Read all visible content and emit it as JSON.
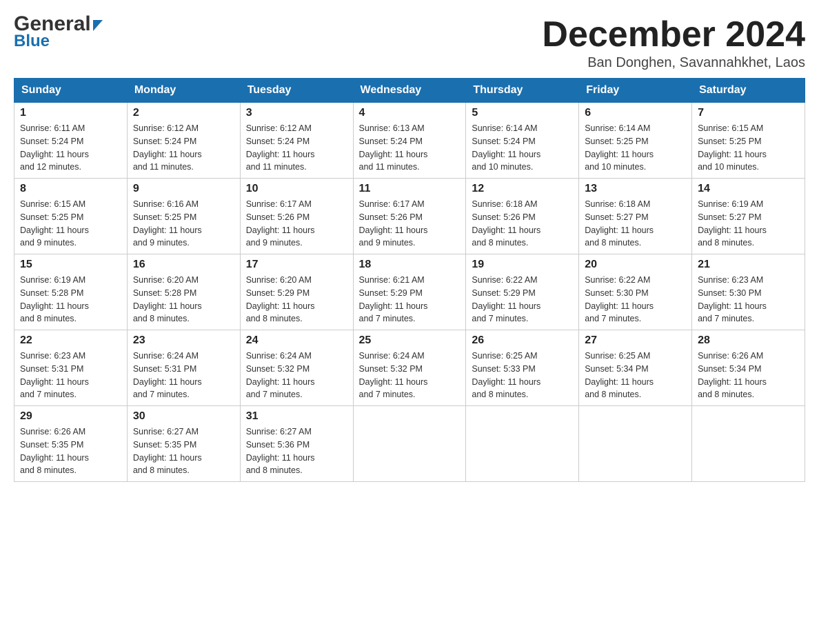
{
  "header": {
    "logo_top": "General",
    "logo_bottom": "Blue",
    "month_title": "December 2024",
    "location": "Ban Donghen, Savannahkhet, Laos"
  },
  "days_of_week": [
    "Sunday",
    "Monday",
    "Tuesday",
    "Wednesday",
    "Thursday",
    "Friday",
    "Saturday"
  ],
  "weeks": [
    [
      {
        "day": "1",
        "sunrise": "6:11 AM",
        "sunset": "5:24 PM",
        "daylight": "11 hours and 12 minutes."
      },
      {
        "day": "2",
        "sunrise": "6:12 AM",
        "sunset": "5:24 PM",
        "daylight": "11 hours and 11 minutes."
      },
      {
        "day": "3",
        "sunrise": "6:12 AM",
        "sunset": "5:24 PM",
        "daylight": "11 hours and 11 minutes."
      },
      {
        "day": "4",
        "sunrise": "6:13 AM",
        "sunset": "5:24 PM",
        "daylight": "11 hours and 11 minutes."
      },
      {
        "day": "5",
        "sunrise": "6:14 AM",
        "sunset": "5:24 PM",
        "daylight": "11 hours and 10 minutes."
      },
      {
        "day": "6",
        "sunrise": "6:14 AM",
        "sunset": "5:25 PM",
        "daylight": "11 hours and 10 minutes."
      },
      {
        "day": "7",
        "sunrise": "6:15 AM",
        "sunset": "5:25 PM",
        "daylight": "11 hours and 10 minutes."
      }
    ],
    [
      {
        "day": "8",
        "sunrise": "6:15 AM",
        "sunset": "5:25 PM",
        "daylight": "11 hours and 9 minutes."
      },
      {
        "day": "9",
        "sunrise": "6:16 AM",
        "sunset": "5:25 PM",
        "daylight": "11 hours and 9 minutes."
      },
      {
        "day": "10",
        "sunrise": "6:17 AM",
        "sunset": "5:26 PM",
        "daylight": "11 hours and 9 minutes."
      },
      {
        "day": "11",
        "sunrise": "6:17 AM",
        "sunset": "5:26 PM",
        "daylight": "11 hours and 9 minutes."
      },
      {
        "day": "12",
        "sunrise": "6:18 AM",
        "sunset": "5:26 PM",
        "daylight": "11 hours and 8 minutes."
      },
      {
        "day": "13",
        "sunrise": "6:18 AM",
        "sunset": "5:27 PM",
        "daylight": "11 hours and 8 minutes."
      },
      {
        "day": "14",
        "sunrise": "6:19 AM",
        "sunset": "5:27 PM",
        "daylight": "11 hours and 8 minutes."
      }
    ],
    [
      {
        "day": "15",
        "sunrise": "6:19 AM",
        "sunset": "5:28 PM",
        "daylight": "11 hours and 8 minutes."
      },
      {
        "day": "16",
        "sunrise": "6:20 AM",
        "sunset": "5:28 PM",
        "daylight": "11 hours and 8 minutes."
      },
      {
        "day": "17",
        "sunrise": "6:20 AM",
        "sunset": "5:29 PM",
        "daylight": "11 hours and 8 minutes."
      },
      {
        "day": "18",
        "sunrise": "6:21 AM",
        "sunset": "5:29 PM",
        "daylight": "11 hours and 7 minutes."
      },
      {
        "day": "19",
        "sunrise": "6:22 AM",
        "sunset": "5:29 PM",
        "daylight": "11 hours and 7 minutes."
      },
      {
        "day": "20",
        "sunrise": "6:22 AM",
        "sunset": "5:30 PM",
        "daylight": "11 hours and 7 minutes."
      },
      {
        "day": "21",
        "sunrise": "6:23 AM",
        "sunset": "5:30 PM",
        "daylight": "11 hours and 7 minutes."
      }
    ],
    [
      {
        "day": "22",
        "sunrise": "6:23 AM",
        "sunset": "5:31 PM",
        "daylight": "11 hours and 7 minutes."
      },
      {
        "day": "23",
        "sunrise": "6:24 AM",
        "sunset": "5:31 PM",
        "daylight": "11 hours and 7 minutes."
      },
      {
        "day": "24",
        "sunrise": "6:24 AM",
        "sunset": "5:32 PM",
        "daylight": "11 hours and 7 minutes."
      },
      {
        "day": "25",
        "sunrise": "6:24 AM",
        "sunset": "5:32 PM",
        "daylight": "11 hours and 7 minutes."
      },
      {
        "day": "26",
        "sunrise": "6:25 AM",
        "sunset": "5:33 PM",
        "daylight": "11 hours and 8 minutes."
      },
      {
        "day": "27",
        "sunrise": "6:25 AM",
        "sunset": "5:34 PM",
        "daylight": "11 hours and 8 minutes."
      },
      {
        "day": "28",
        "sunrise": "6:26 AM",
        "sunset": "5:34 PM",
        "daylight": "11 hours and 8 minutes."
      }
    ],
    [
      {
        "day": "29",
        "sunrise": "6:26 AM",
        "sunset": "5:35 PM",
        "daylight": "11 hours and 8 minutes."
      },
      {
        "day": "30",
        "sunrise": "6:27 AM",
        "sunset": "5:35 PM",
        "daylight": "11 hours and 8 minutes."
      },
      {
        "day": "31",
        "sunrise": "6:27 AM",
        "sunset": "5:36 PM",
        "daylight": "11 hours and 8 minutes."
      },
      null,
      null,
      null,
      null
    ]
  ],
  "labels": {
    "sunrise_prefix": "Sunrise: ",
    "sunset_prefix": "Sunset: ",
    "daylight_prefix": "Daylight: "
  }
}
